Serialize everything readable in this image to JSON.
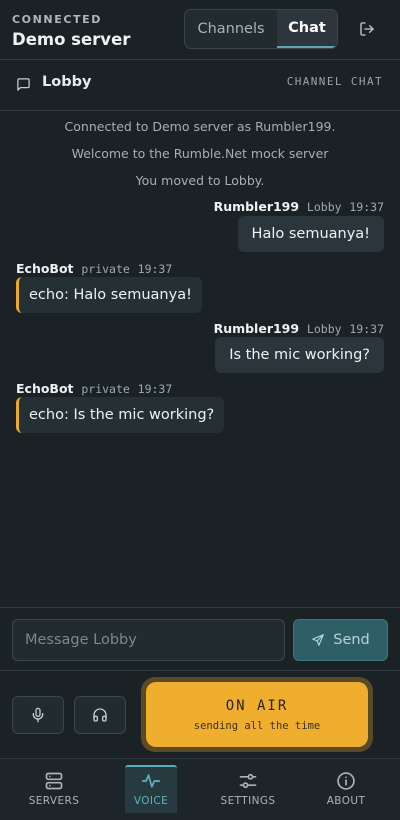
{
  "header": {
    "status": "CONNECTED",
    "server_name": "Demo server",
    "tabs": [
      {
        "label": "Channels",
        "active": false
      },
      {
        "label": "Chat",
        "active": true
      }
    ],
    "logout_icon": "logout-icon"
  },
  "channel": {
    "icon": "message-square-icon",
    "name": "Lobby",
    "mode_label": "CHANNEL CHAT"
  },
  "messages": {
    "system": [
      "Connected to Demo server as Rumbler199.",
      "Welcome to the Rumble.Net mock server",
      "You moved to Lobby."
    ],
    "chat": [
      {
        "sender": "Rumbler199",
        "scope": "Lobby",
        "time": "19:37",
        "text": "Halo semuanya!",
        "direction": "outgoing"
      },
      {
        "sender": "EchoBot",
        "scope": "private",
        "time": "19:37",
        "text": "echo: Halo semuanya!",
        "direction": "incoming"
      },
      {
        "sender": "Rumbler199",
        "scope": "Lobby",
        "time": "19:37",
        "text": "Is the mic working?",
        "direction": "outgoing"
      },
      {
        "sender": "EchoBot",
        "scope": "private",
        "time": "19:37",
        "text": "echo: Is the mic working?",
        "direction": "incoming"
      }
    ]
  },
  "composer": {
    "placeholder": "Message Lobby",
    "value": "",
    "send_label": "Send",
    "send_icon": "send-icon"
  },
  "controls": {
    "mic_icon": "mic-icon",
    "headphones_icon": "headphones-icon",
    "on_air_title": "ON AIR",
    "on_air_subtitle": "sending all the time"
  },
  "nav": [
    {
      "label": "SERVERS",
      "icon": "servers-icon",
      "active": false
    },
    {
      "label": "VOICE",
      "icon": "activity-icon",
      "active": true
    },
    {
      "label": "SETTINGS",
      "icon": "sliders-icon",
      "active": false
    },
    {
      "label": "ABOUT",
      "icon": "info-icon",
      "active": false
    }
  ],
  "colors": {
    "background": "#1b2226",
    "accent": "#5aa8b2",
    "on_air": "#f0ae2e",
    "incoming_marker": "#eaaa2b"
  }
}
